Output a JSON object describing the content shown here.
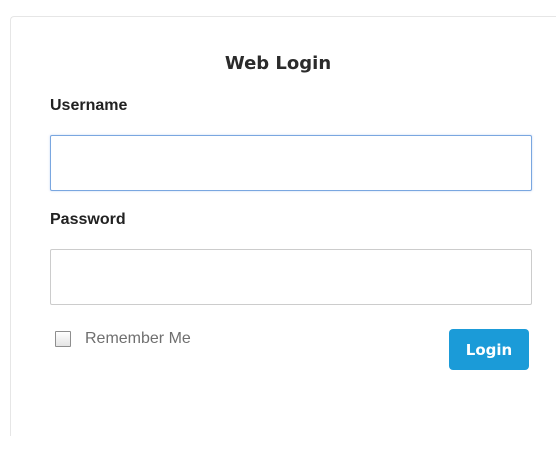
{
  "form": {
    "title": "Web Login",
    "username_label": "Username",
    "username_value": "",
    "password_label": "Password",
    "password_value": "",
    "remember_label": "Remember Me",
    "remember_checked": false,
    "submit_label": "Login"
  },
  "colors": {
    "button": "#1b9bd8",
    "focus_border": "#7aa7e0"
  }
}
